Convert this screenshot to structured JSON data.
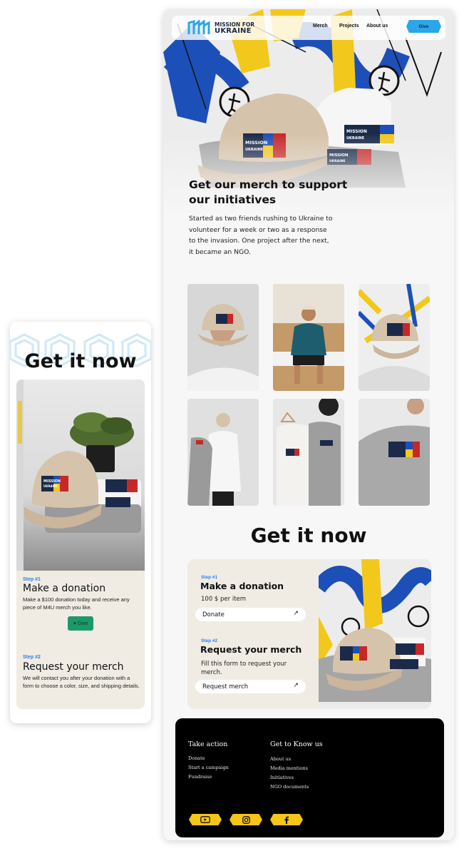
{
  "mobile": {
    "title": "Get it now",
    "step1": {
      "label": "Step #1",
      "heading": "Make a donation",
      "text": "Make a $100 donation today and receive any piece of M4U merch you like.",
      "give_label": "Give"
    },
    "step2": {
      "label": "Step #2",
      "heading": "Request your merch",
      "text": "We will contact you after your donation with a form to choose a color, size, and shipping details."
    }
  },
  "desktop": {
    "logo": {
      "line1": "MISSION FOR",
      "line2": "UKRAINE"
    },
    "nav": {
      "items": [
        "Merch",
        "Projects",
        "About us"
      ],
      "give_label": "Give"
    },
    "hero": {
      "title": "Get our merch to support our initiatives",
      "text": "Started as two friends rushing to Ukraine to volunteer for a week or two as a response to the invasion. One project after the next, it became an NGO."
    },
    "patch": {
      "line1": "MISSION",
      "line2": "FOR UKRAINE"
    },
    "get_it_now": {
      "title": "Get it now",
      "step1": {
        "label": "Step #1",
        "heading": "Make a donation",
        "text": "100 $ per item",
        "button": "Donate"
      },
      "step2": {
        "label": "Step #2",
        "heading": "Request your merch",
        "text": "Fill this form to request your merch.",
        "button": "Request merch"
      }
    },
    "footer": {
      "take_action": {
        "heading": "Take action",
        "links": [
          "Donate",
          "Start a campaign",
          "Fundraise"
        ]
      },
      "get_to_know": {
        "heading": "Get to Know us",
        "links": [
          "About us",
          "Media mentions",
          "Initiatives",
          "NGO documents"
        ]
      },
      "social_icons": [
        "youtube-icon",
        "instagram-icon",
        "facebook-icon"
      ]
    }
  },
  "colors": {
    "accent_blue": "#2aa7e8",
    "step_blue": "#2f7cf0",
    "give_green": "#1a9a6a",
    "card_beige": "#f0ece4",
    "social_yellow": "#f5c518",
    "ukraine_blue": "#1c4fb8",
    "ukraine_yellow": "#f2c81c",
    "patch_red": "#c62828"
  }
}
